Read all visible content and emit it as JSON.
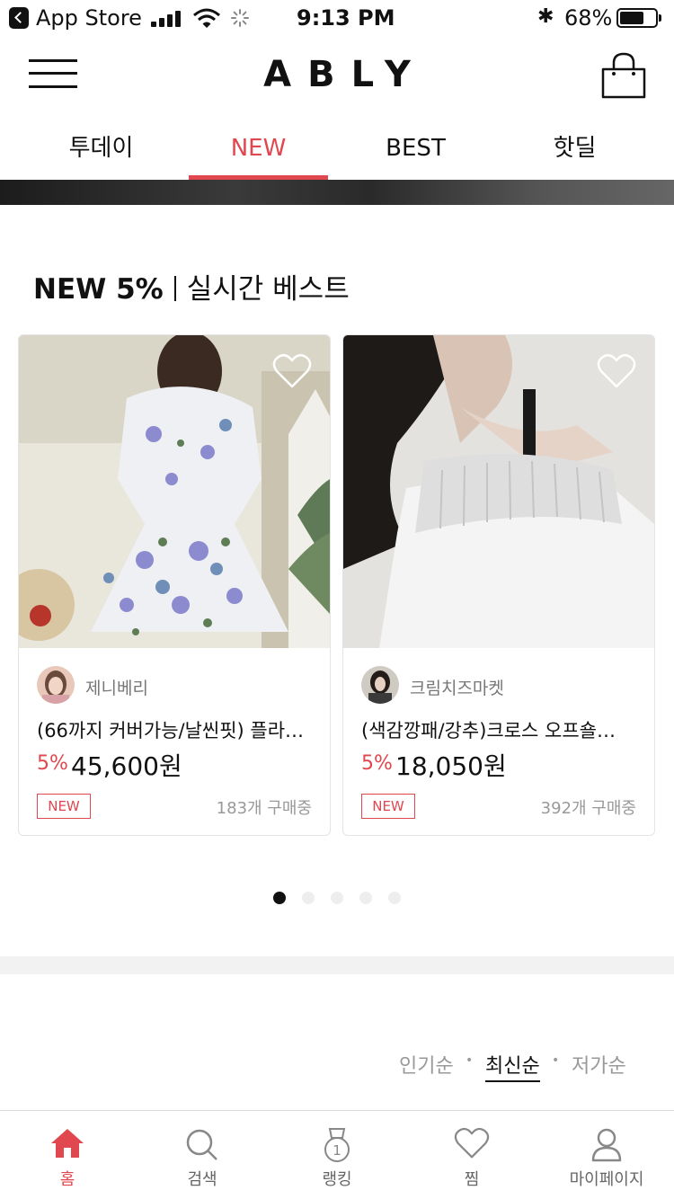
{
  "status_bar": {
    "back_app": "App Store",
    "time": "9:13 PM",
    "battery_percent": "68%",
    "battery_level": 0.68
  },
  "header": {
    "logo": "ABLY",
    "menu_icon": "hamburger-icon",
    "cart_icon": "shopping-bag-icon"
  },
  "tabs": [
    {
      "label": "투데이",
      "active": false
    },
    {
      "label": "NEW",
      "active": true
    },
    {
      "label": "BEST",
      "active": false
    },
    {
      "label": "핫딜",
      "active": false
    }
  ],
  "section": {
    "title_bold": "NEW 5%",
    "title_rest": "실시간 베스트"
  },
  "products": [
    {
      "shop": "제니베리",
      "name": "(66까지 커버가능/날씬핏) 플라…",
      "discount": "5%",
      "price": "45,600원",
      "badge": "NEW",
      "buyers": "183개 구매중"
    },
    {
      "shop": "크림치즈마켓",
      "name": "(색감깡패/강추)크로스 오프숄…",
      "discount": "5%",
      "price": "18,050원",
      "badge": "NEW",
      "buyers": "392개 구매중"
    }
  ],
  "carousel": {
    "pages": 5,
    "current": 1
  },
  "sort": {
    "options": [
      "인기순",
      "최신순",
      "저가순"
    ],
    "selected": "최신순"
  },
  "bottom_nav": [
    {
      "label": "홈",
      "icon": "home-icon",
      "active": true
    },
    {
      "label": "검색",
      "icon": "search-icon",
      "active": false
    },
    {
      "label": "랭킹",
      "icon": "ranking-medal-icon",
      "active": false
    },
    {
      "label": "찜",
      "icon": "heart-icon",
      "active": false
    },
    {
      "label": "마이페이지",
      "icon": "person-icon",
      "active": false
    }
  ],
  "colors": {
    "accent": "#e0474f",
    "text": "#111111",
    "muted": "#999999"
  }
}
